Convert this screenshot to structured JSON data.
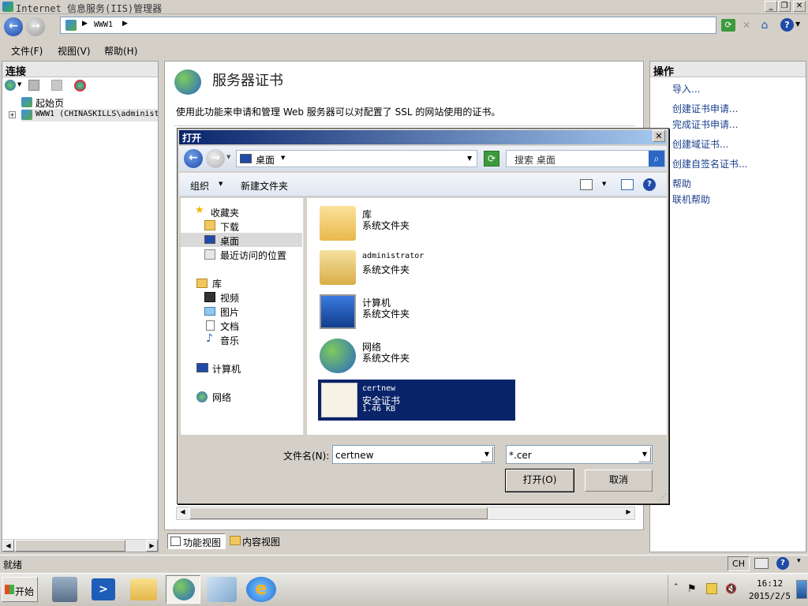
{
  "window": {
    "title": "Internet 信息服务(IIS)管理器"
  },
  "address": {
    "path_segment": "WWW1"
  },
  "menu": {
    "file": "文件(F)",
    "view": "视图(V)",
    "help": "帮助(H)"
  },
  "connections": {
    "header": "连接",
    "tree": [
      {
        "label": "起始页"
      },
      {
        "label": "WWW1 (CHINASKILLS\\administ"
      }
    ]
  },
  "center": {
    "page_title": "服务器证书",
    "description": "使用此功能来申请和管理 Web 服务器可以对配置了 SSL 的网站使用的证书。",
    "tabs": {
      "features": "功能视图",
      "content": "内容视图"
    }
  },
  "actions": {
    "header": "操作",
    "items": [
      "导入...",
      "创建证书申请...",
      "完成证书申请...",
      "创建域证书...",
      "创建自签名证书...",
      "帮助",
      "联机帮助"
    ]
  },
  "status": {
    "text": "就绪",
    "lang": "CH"
  },
  "taskbar": {
    "start": "开始",
    "time": "16:12",
    "date": "2015/2/5"
  },
  "dialog": {
    "title": "打开",
    "location": "桌面",
    "search_placeholder": "搜索 桌面",
    "toolbar": {
      "organize": "组织",
      "new_folder": "新建文件夹"
    },
    "nav": {
      "favorites": "收藏夹",
      "downloads": "下载",
      "desktop": "桌面",
      "recent": "最近访问的位置",
      "libraries": "库",
      "videos": "视频",
      "pictures": "图片",
      "documents": "文档",
      "music": "音乐",
      "computer": "计算机",
      "network": "网络"
    },
    "files": [
      {
        "name": "库",
        "type": "系统文件夹"
      },
      {
        "name": "administrator",
        "type": "系统文件夹"
      },
      {
        "name": "计算机",
        "type": "系统文件夹"
      },
      {
        "name": "网络",
        "type": "系统文件夹"
      },
      {
        "name": "certnew",
        "type": "安全证书",
        "size": "1.46 KB"
      }
    ],
    "filename_label": "文件名(N):",
    "filename_value": "certnew",
    "filter_value": "*.cer",
    "open_button": "打开(O)",
    "cancel_button": "取消"
  }
}
